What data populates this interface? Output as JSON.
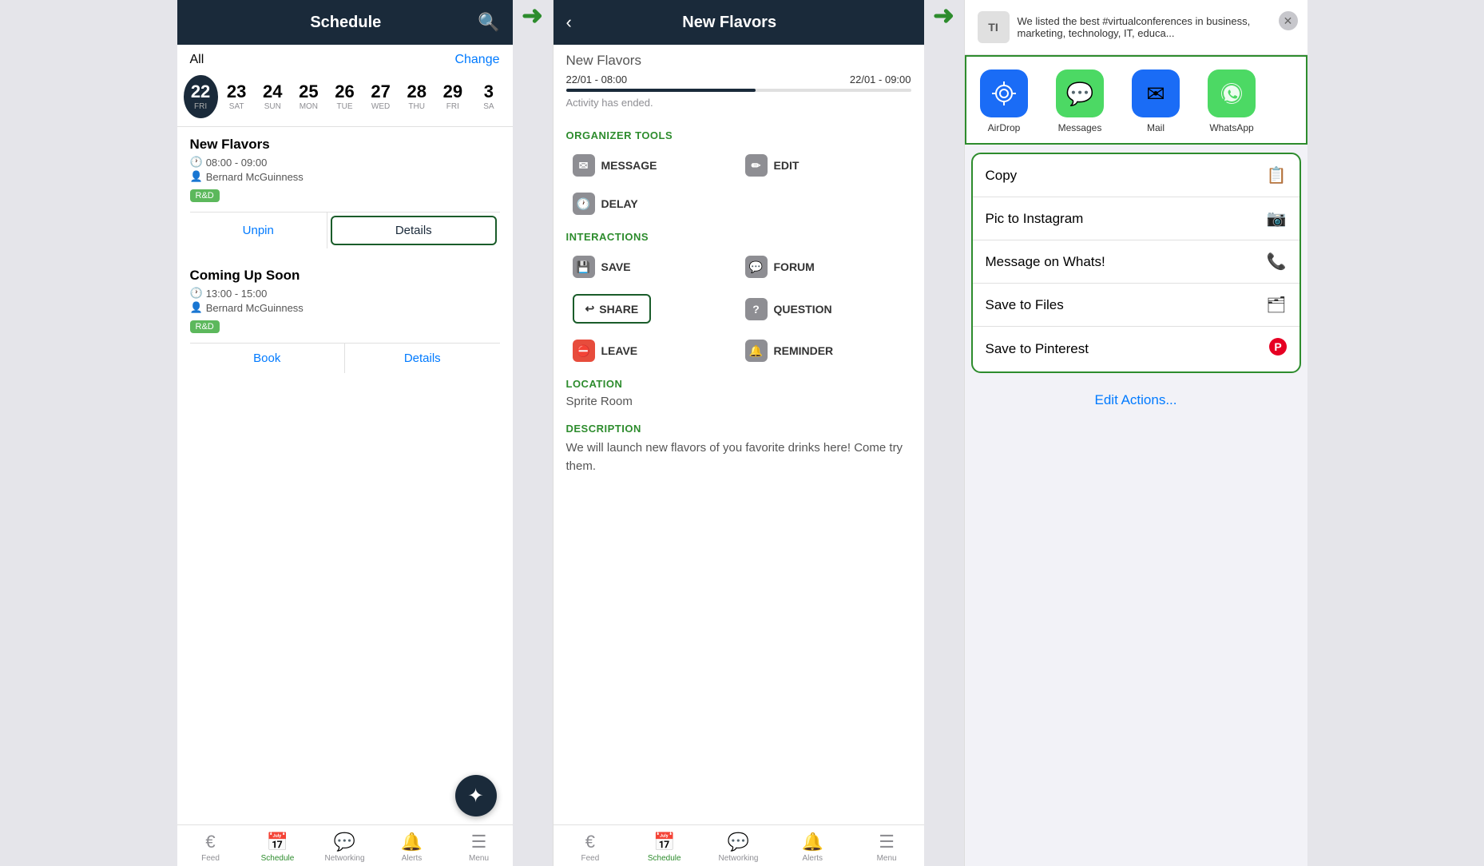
{
  "panel1": {
    "header": {
      "title": "Schedule",
      "search_label": "🔍"
    },
    "all_label": "All",
    "change_label": "Change",
    "dates": [
      {
        "num": "22",
        "day": "FRI",
        "active": true
      },
      {
        "num": "23",
        "day": "SAT",
        "active": false
      },
      {
        "num": "24",
        "day": "SUN",
        "active": false
      },
      {
        "num": "25",
        "day": "MON",
        "active": false
      },
      {
        "num": "26",
        "day": "TUE",
        "active": false
      },
      {
        "num": "27",
        "day": "WED",
        "active": false
      },
      {
        "num": "28",
        "day": "THU",
        "active": false
      },
      {
        "num": "29",
        "day": "FRI",
        "active": false
      },
      {
        "num": "3",
        "day": "SA",
        "active": false
      }
    ],
    "events": [
      {
        "title": "New Flavors",
        "time": "08:00 - 09:00",
        "organizer": "Bernard McGuinness",
        "tag": "R&D",
        "actions": [
          "Unpin",
          "Details"
        ]
      },
      {
        "title": "Coming Up Soon",
        "time": "13:00 - 15:00",
        "organizer": "Bernard McGuinness",
        "tag": "R&D",
        "actions": [
          "Book",
          "Details"
        ]
      }
    ],
    "nav": [
      {
        "label": "Feed",
        "icon": "€",
        "active": false
      },
      {
        "label": "Schedule",
        "icon": "📅",
        "active": true
      },
      {
        "label": "Networking",
        "icon": "💬",
        "active": false
      },
      {
        "label": "Alerts",
        "icon": "🔔",
        "active": false
      },
      {
        "label": "Menu",
        "icon": "☰",
        "active": false
      }
    ]
  },
  "panel2": {
    "back_label": "‹",
    "title": "New Flavors",
    "subtitle": "New Flavors",
    "time_start": "22/01 - 08:00",
    "time_end": "22/01 - 09:00",
    "activity_ended": "Activity has ended.",
    "organizer_tools_label": "ORGANIZER TOOLS",
    "tools": [
      {
        "label": "MESSAGE",
        "icon": "✉"
      },
      {
        "label": "EDIT",
        "icon": "✏"
      },
      {
        "label": "DELAY",
        "icon": "🕐"
      }
    ],
    "interactions_label": "INTERACTIONS",
    "interactions": [
      {
        "label": "SAVE",
        "icon": "💾"
      },
      {
        "label": "FORUM",
        "icon": "💬"
      },
      {
        "label": "SHARE",
        "icon": "↩",
        "outlined": true
      },
      {
        "label": "QUESTION",
        "icon": "?"
      },
      {
        "label": "LEAVE",
        "icon": "⛔"
      },
      {
        "label": "REMINDER",
        "icon": "🔔"
      }
    ],
    "location_label": "LOCATION",
    "location": "Sprite Room",
    "description_label": "DESCRIPTION",
    "description": "We will launch new flavors of you favorite drinks here! Come try them.",
    "nav": [
      {
        "label": "Feed",
        "icon": "€",
        "active": false
      },
      {
        "label": "Schedule",
        "icon": "📅",
        "active": true
      },
      {
        "label": "Networking",
        "icon": "💬",
        "active": false
      },
      {
        "label": "Alerts",
        "icon": "🔔",
        "active": false
      },
      {
        "label": "Menu",
        "icon": "☰",
        "active": false
      }
    ]
  },
  "panel3": {
    "message_preview": "We listed the best #virtualconferences in business, marketing, technology, IT, educa...",
    "message_avatar": "TI",
    "apps": [
      {
        "label": "AirDrop",
        "icon": "📡",
        "color": "#1a6cf6"
      },
      {
        "label": "Messages",
        "icon": "💬",
        "color": "#4cd964"
      },
      {
        "label": "Mail",
        "icon": "✉",
        "color": "#1a6cf6"
      },
      {
        "label": "WhatsApp",
        "icon": "📱",
        "color": "#4cd964"
      }
    ],
    "actions": [
      {
        "label": "Copy",
        "icon": "📋"
      },
      {
        "label": "Pic to Instagram",
        "icon": "📷"
      },
      {
        "label": "Message on Whats!",
        "icon": "📞"
      },
      {
        "label": "Save to Files",
        "icon": "🗂"
      },
      {
        "label": "Save to Pinterest",
        "icon": "📌"
      }
    ],
    "edit_actions_label": "Edit Actions..."
  },
  "arrows": {
    "arrow1": "➡",
    "arrow2": "➡"
  }
}
